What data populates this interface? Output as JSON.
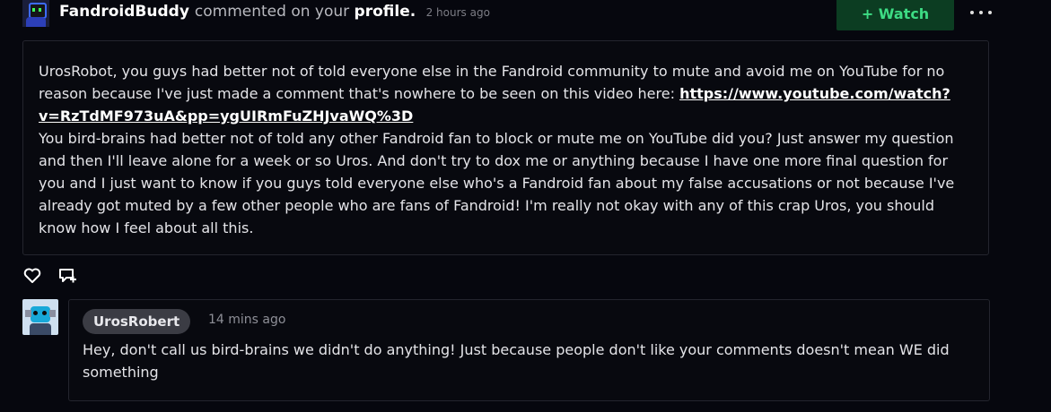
{
  "header": {
    "username": "FandroidBuddy",
    "action_text": "commented on your",
    "profile_link": "profile.",
    "timestamp": "2 hours ago",
    "watch_label": "+ Watch"
  },
  "comment": {
    "para1_before_link": "UrosRobot, you guys had better not of told everyone else in the Fandroid community to mute and avoid me on YouTube for no reason because I've just made a comment that's nowhere to be seen on this video here: ",
    "link_text": "https://www.youtube.com/watch?v=RzTdMF973uA&pp=ygUIRmFuZHJvaWQ%3D",
    "para2": "You bird-brains had better not of told any other Fandroid fan to block or mute me on YouTube did you? Just answer my question and then I'll leave alone for a week or so Uros. And don't try to dox me or anything because I have one more final question for you and I just want to know if you guys told everyone else who's a Fandroid fan about my false accusations or not because I've already got muted by a few other people who are fans of Fandroid! I'm really not okay with any of this crap Uros, you should know how I feel about all this."
  },
  "actions": {
    "icons": [
      "heart-icon",
      "reply-icon"
    ]
  },
  "reply": {
    "username": "UrosRobert",
    "timestamp": "14 mins ago",
    "text": "Hey, don't call us bird-brains we didn't do anything! Just because people don't like your comments doesn't mean WE did something"
  },
  "colors": {
    "background": "#06070e",
    "watch_bg": "#0c3d22",
    "watch_text": "#3ddc84",
    "border": "#24252e",
    "pill_bg": "#3b3c44"
  }
}
